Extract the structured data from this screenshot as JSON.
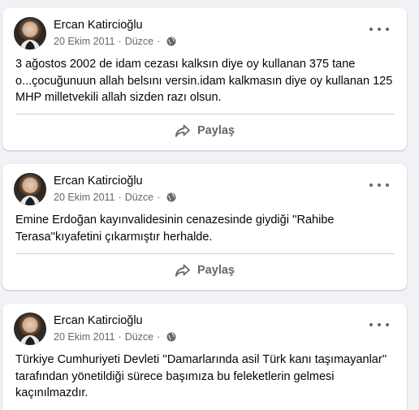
{
  "posts": [
    {
      "author": "Ercan Katircioğlu",
      "date": "20 Ekim 2011",
      "separator": "·",
      "location": "Düzce",
      "audience_icon": "globe-icon",
      "text": "3 ağostos 2002 de idam cezası kalksın diye oy kullanan 375 tane o...çocuğunuun allah belsını versin.idam kalkmasın diye oy kullanan 125 MHP milletvekili allah sizden razı olsun.",
      "share_label": "Paylaş"
    },
    {
      "author": "Ercan Katircioğlu",
      "date": "20 Ekim 2011",
      "separator": "·",
      "location": "Düzce",
      "audience_icon": "globe-icon",
      "text": "Emine Erdoğan kayınvalidesinin cenazesinde giydiği ''Rahibe Terasa''kıyafetini çıkarmıştır herhalde.",
      "share_label": "Paylaş"
    },
    {
      "author": "Ercan Katircioğlu",
      "date": "20 Ekim 2011",
      "separator": "·",
      "location": "Düzce",
      "audience_icon": "globe-icon",
      "text": "Türkiye Cumhuriyeti Devleti ''Damarlarında asil Türk kanı taşımayanlar'' tarafından yönetildiği sürece başımıza bu feleketlerin gelmesi kaçınılmazdır."
    }
  ],
  "colors": {
    "background": "#f0f2f5",
    "card": "#ffffff",
    "primary_text": "#050505",
    "secondary_text": "#65676b",
    "divider": "#ced0d4"
  }
}
